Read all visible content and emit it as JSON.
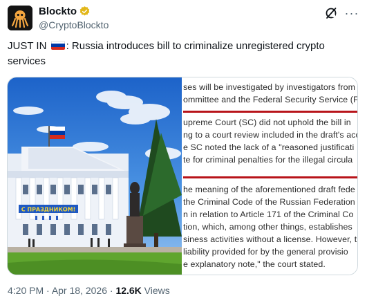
{
  "author": {
    "display_name": "Blockto",
    "handle": "@CryptoBlockto",
    "avatar_icon": "octopus-logo-icon",
    "verified_icon": "gold-verified-badge-icon",
    "verified_color": "#e2b719"
  },
  "actions": {
    "grok_icon": "grok-slash-icon",
    "more_label": "···"
  },
  "tweet": {
    "text_before_flag": "JUST IN",
    "flag_icon": "russia-flag-icon",
    "text_after_flag": ": Russia introduces bill to criminalize unregistered crypto services"
  },
  "media": {
    "left_photo": {
      "icon": "government-building-photo",
      "banner_text": "С ПРАЗДНИКОМ!"
    },
    "right_document": {
      "rule_color": "#b8141a",
      "lines": [
        "ses will be investigated by investigators from",
        "ommittee and the Federal Security Service (F",
        "upreme Court (SC) did not uphold the bill in",
        "ng to a court review included in the draft's acc",
        "e SC noted the lack of a \"reasoned justificati",
        "te for criminal penalties for the illegal circula",
        "he meaning of the aforementioned draft fede",
        "the Criminal Code of the Russian Federation",
        "n in relation to Article 171 of the Criminal Co",
        "tion, which, among other things, establishes",
        "siness activities without a license. However, t",
        " liability provided for by the general provisio",
        "e explanatory note,\" the court stated."
      ]
    }
  },
  "meta": {
    "time": "4:20 PM",
    "separator": " · ",
    "date": "Apr 18, 2026",
    "views_count": "12.6K",
    "views_label": " Views"
  }
}
